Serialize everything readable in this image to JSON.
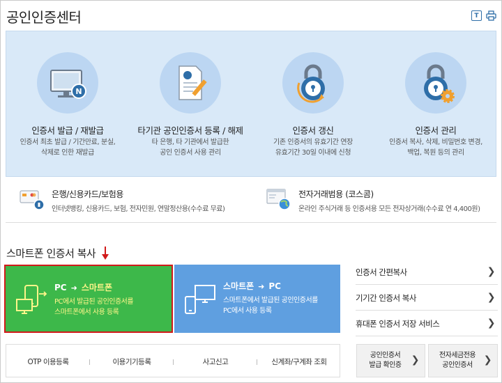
{
  "header": {
    "title": "공인인증센터",
    "tool_icons": [
      "text-size-icon",
      "print-icon"
    ]
  },
  "services": [
    {
      "title": "인증서 발급 / 재발급",
      "desc1": "인증서 최초 발급 / 기간만료, 분실,",
      "desc2": "삭제로 인한 재발급",
      "icon": "monitor-certificate-icon"
    },
    {
      "title": "타기관 공인인증서 등록 / 해제",
      "desc1": "타 은행, 타 기관에서 발급한",
      "desc2": "공인 인증서 사용 관리",
      "icon": "document-pen-icon"
    },
    {
      "title": "인증서 갱신",
      "desc1": "기존 인증서의 유효기간 연장",
      "desc2": "유효기간 30일 이내에 신청",
      "icon": "lock-refresh-icon"
    },
    {
      "title": "인증서 관리",
      "desc1": "인증서 복사, 삭제, 비밀번호 변경,",
      "desc2": "백업, 복원 등의 관리",
      "icon": "lock-gear-icon"
    }
  ],
  "usage": [
    {
      "title": "은행/신용카드/보험용",
      "desc": "인터넷뱅킹, 신용카드, 보험, 전자민원, 연말정산용(수수료 무료)",
      "icon": "card-certificate-icon"
    },
    {
      "title": "전자거래범용 (코스콤)",
      "desc": "온라인 주식거래 등 인증서용 모든 전자상거래(수수료 연 4,400원)",
      "icon": "globe-window-icon"
    }
  ],
  "smartphone": {
    "title": "스마트폰 인증서 복사",
    "cards": [
      {
        "from": "PC",
        "arrow": "➜",
        "to": "스마트폰",
        "desc1": "PC에서 발급된 공인인증서를",
        "desc2": "스마트폰에서 사용 등록"
      },
      {
        "from": "스마트폰",
        "arrow": "➜",
        "to": "PC",
        "desc1": "스마트폰에서 발급된 공인인증서를",
        "desc2": "PC에서 사용 등록"
      }
    ]
  },
  "right_links": [
    {
      "label": "인증서 간편복사"
    },
    {
      "label": "기기간 인증서 복사"
    },
    {
      "label": "휴대폰 인증서 저장 서비스"
    }
  ],
  "bottom_links": [
    "OTP 이용등록",
    "이용기기등록",
    "사고신고",
    "신계좌/구계좌 조회"
  ],
  "box_buttons": [
    {
      "line1": "공인인증서",
      "line2": "발급 확인증"
    },
    {
      "line1": "전자세금전용",
      "line2": "공인인증서"
    }
  ],
  "chevron": "❯",
  "colors": {
    "panel_bg": "#d9e9f8",
    "circle_bg": "#bcd6f2",
    "green_card": "#3db84a",
    "blue_card": "#5f9fe0",
    "highlight_border": "#d11a1a",
    "accent_yellow": "#fff58a"
  }
}
